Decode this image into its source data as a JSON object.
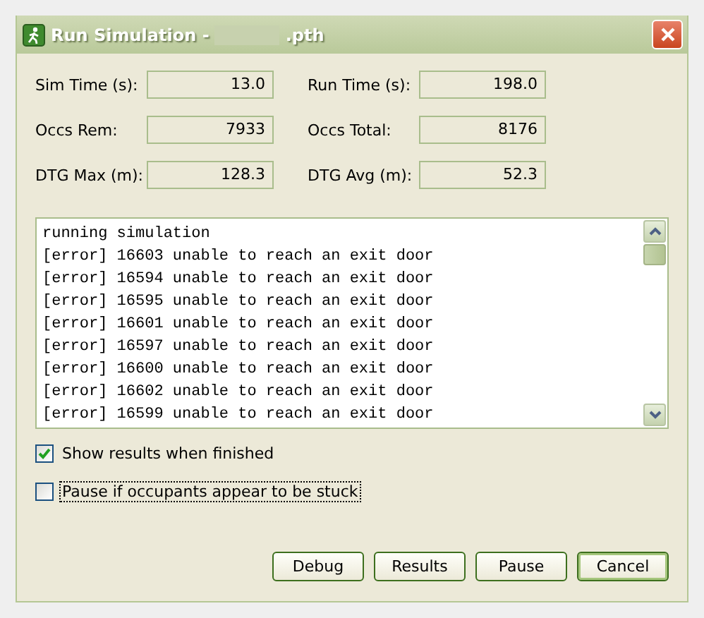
{
  "window": {
    "title_start": "Run Simulation -",
    "title_end": ".pth",
    "title_redacted": true
  },
  "stats": [
    {
      "label": "Sim Time (s):",
      "value": "13.0"
    },
    {
      "label": "Run Time (s):",
      "value": "198.0"
    },
    {
      "label": "Occs Rem:",
      "value": "7933"
    },
    {
      "label": "Occs Total:",
      "value": "8176"
    },
    {
      "label": "DTG Max (m):",
      "value": "128.3"
    },
    {
      "label": "DTG Avg (m):",
      "value": "52.3"
    }
  ],
  "log": [
    "running simulation",
    "[error] 16603 unable to reach an exit door",
    "[error] 16594 unable to reach an exit door",
    "[error] 16595 unable to reach an exit door",
    "[error] 16601 unable to reach an exit door",
    "[error] 16597 unable to reach an exit door",
    "[error] 16600 unable to reach an exit door",
    "[error] 16602 unable to reach an exit door",
    "[error] 16599 unable to reach an exit door"
  ],
  "options": [
    {
      "label": "Show results when finished",
      "checked": true,
      "focused": false
    },
    {
      "label": "Pause if occupants appear to be stuck",
      "checked": false,
      "focused": true
    }
  ],
  "buttons": [
    {
      "label": "Debug",
      "default": false
    },
    {
      "label": "Results",
      "default": false
    },
    {
      "label": "Pause",
      "default": false
    },
    {
      "label": "Cancel",
      "default": true
    }
  ]
}
